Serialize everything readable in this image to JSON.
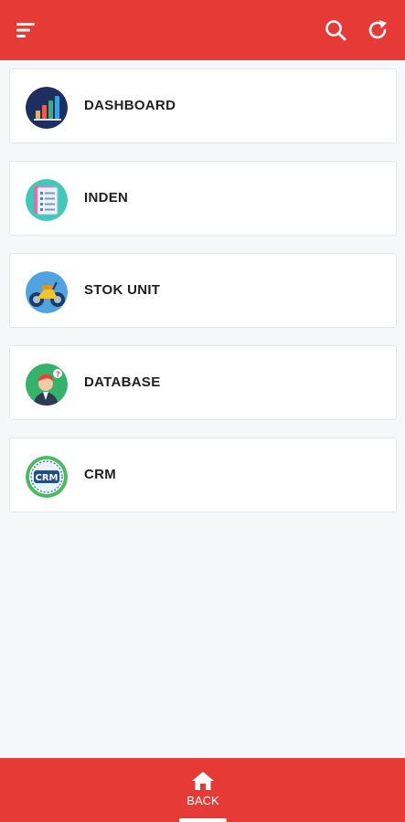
{
  "colors": {
    "primary": "#e53a36",
    "background": "#f6f7f9"
  },
  "appbar": {
    "menu_icon": "menu-icon",
    "search_icon": "search-icon",
    "refresh_icon": "refresh-icon"
  },
  "menu": {
    "items": [
      {
        "label": "DASHBOARD",
        "icon": "dashboard-chart-icon"
      },
      {
        "label": "INDEN",
        "icon": "document-list-icon"
      },
      {
        "label": "STOK UNIT",
        "icon": "motorcycle-icon"
      },
      {
        "label": "DATABASE",
        "icon": "person-question-icon"
      },
      {
        "label": "CRM",
        "icon": "crm-badge-icon"
      }
    ]
  },
  "bottom_nav": {
    "back_label": "BACK",
    "icon": "home-icon"
  },
  "crm_badge_text": "CRM"
}
